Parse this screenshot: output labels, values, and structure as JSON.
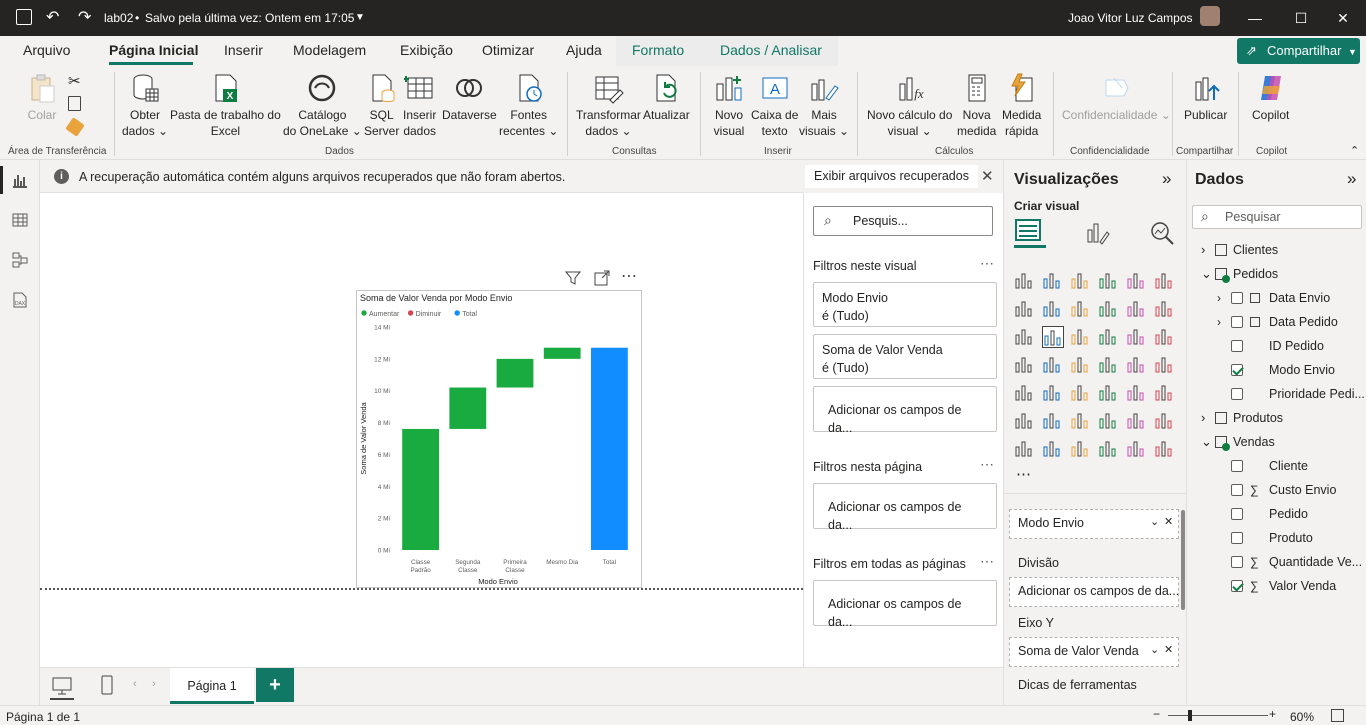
{
  "titlebar": {
    "file": "lab02",
    "saved": "Salvo pela última vez: Ontem em 17:05",
    "user": "Joao Vitor Luz Campos"
  },
  "menu_tabs": [
    "Arquivo",
    "Página Inicial",
    "Inserir",
    "Modelagem",
    "Exibição",
    "Otimizar",
    "Ajuda",
    "Formato",
    "Dados / Analisar"
  ],
  "share_label": "Compartilhar",
  "ribbon": {
    "colar": "Colar",
    "obter": [
      "Obter",
      "dados"
    ],
    "pasta": [
      "Pasta de trabalho do",
      "Excel"
    ],
    "catalogo": [
      "Catálogo",
      "do OneLake"
    ],
    "sql": [
      "SQL",
      "Server"
    ],
    "inserir_dados": [
      "Inserir",
      "dados"
    ],
    "dataverse": "Dataverse",
    "fontes": [
      "Fontes",
      "recentes"
    ],
    "transformar": [
      "Transformar",
      "dados"
    ],
    "atualizar": "Atualizar",
    "novo_visual": [
      "Novo",
      "visual"
    ],
    "caixa_texto": [
      "Caixa de",
      "texto"
    ],
    "mais_visuais": [
      "Mais",
      "visuais"
    ],
    "novo_calculo": [
      "Novo cálculo do",
      "visual"
    ],
    "nova_medida": [
      "Nova",
      "medida"
    ],
    "medida_rapida": [
      "Medida",
      "rápida"
    ],
    "confidencialidade": "Confidencialidade",
    "publicar": "Publicar",
    "copilot": "Copilot",
    "groups": [
      "Área de Transferência",
      "Dados",
      "Consultas",
      "Inserir",
      "Cálculos",
      "Confidencialidade",
      "Compartilhar",
      "Copilot"
    ]
  },
  "notification": {
    "text": "A recuperação automática contém alguns arquivos recuperados que não foram abertos.",
    "button": "Exibir arquivos recuperados"
  },
  "chart_data": {
    "type": "bar",
    "subtype": "waterfall",
    "title": "Soma de Valor Venda por Modo Envio",
    "xlabel": "Modo Envio",
    "ylabel": "Soma de Valor Venda",
    "legend": [
      "Aumentar",
      "Diminuir",
      "Total"
    ],
    "legend_colors": [
      "#1aab40",
      "#d64550",
      "#118dff"
    ],
    "ticks": [
      "0 Mi",
      "2 Mi",
      "4 Mi",
      "6 Mi",
      "8 Mi",
      "10 Mi",
      "12 Mi",
      "14 Mi"
    ],
    "ylim": [
      0,
      14
    ],
    "categories": [
      "Classe Padrão",
      "Segunda Classe",
      "Primeira Classe",
      "Mesmo Dia",
      "Total"
    ],
    "category_lines": [
      [
        "Classe",
        "Padrão"
      ],
      [
        "Segunda",
        "Classe"
      ],
      [
        "Primeira",
        "Classe"
      ],
      [
        "Mesmo Dia"
      ],
      [
        "Total"
      ]
    ],
    "values": [
      7.6,
      2.6,
      1.8,
      0.7,
      12.7
    ],
    "kinds": [
      "increase",
      "increase",
      "increase",
      "increase",
      "total"
    ]
  },
  "filters": {
    "search": "Pesquis...",
    "visual_head": "Filtros neste visual",
    "card1": [
      "Modo Envio",
      "é (Tudo)"
    ],
    "card2": [
      "Soma de Valor Venda",
      "é (Tudo)"
    ],
    "add": "Adicionar os campos de da...",
    "page_head": "Filtros nesta página",
    "all_head": "Filtros em todas as páginas"
  },
  "viz": {
    "title": "Visualizações",
    "create": "Criar visual",
    "well1": "Modo Envio",
    "divisao": "Divisão",
    "add": "Adicionar os campos de da...",
    "eixo_y": "Eixo Y",
    "well2": "Soma de Valor Venda",
    "dicas": "Dicas de ferramentas"
  },
  "dados": {
    "title": "Dados",
    "search": "Pesquisar",
    "tables": [
      {
        "name": "Clientes",
        "expanded": false
      },
      {
        "name": "Pedidos",
        "expanded": true,
        "fields": [
          {
            "name": "Data Envio",
            "type": "date",
            "checked": false
          },
          {
            "name": "Data Pedido",
            "type": "date",
            "checked": false
          },
          {
            "name": "ID Pedido",
            "type": "field",
            "checked": false
          },
          {
            "name": "Modo Envio",
            "type": "field",
            "checked": true
          },
          {
            "name": "Prioridade Pedi...",
            "type": "field",
            "checked": false
          }
        ]
      },
      {
        "name": "Produtos",
        "expanded": false
      },
      {
        "name": "Vendas",
        "expanded": true,
        "fields": [
          {
            "name": "Cliente",
            "type": "field",
            "checked": false
          },
          {
            "name": "Custo Envio",
            "type": "sum",
            "checked": false
          },
          {
            "name": "Pedido",
            "type": "field",
            "checked": false
          },
          {
            "name": "Produto",
            "type": "field",
            "checked": false
          },
          {
            "name": "Quantidade Ve...",
            "type": "sum",
            "checked": false
          },
          {
            "name": "Valor Venda",
            "type": "sum",
            "checked": true
          }
        ]
      }
    ]
  },
  "pagebar": {
    "page_tab": "Página 1"
  },
  "status": {
    "page": "Página 1 de 1",
    "zoom": "60%"
  }
}
